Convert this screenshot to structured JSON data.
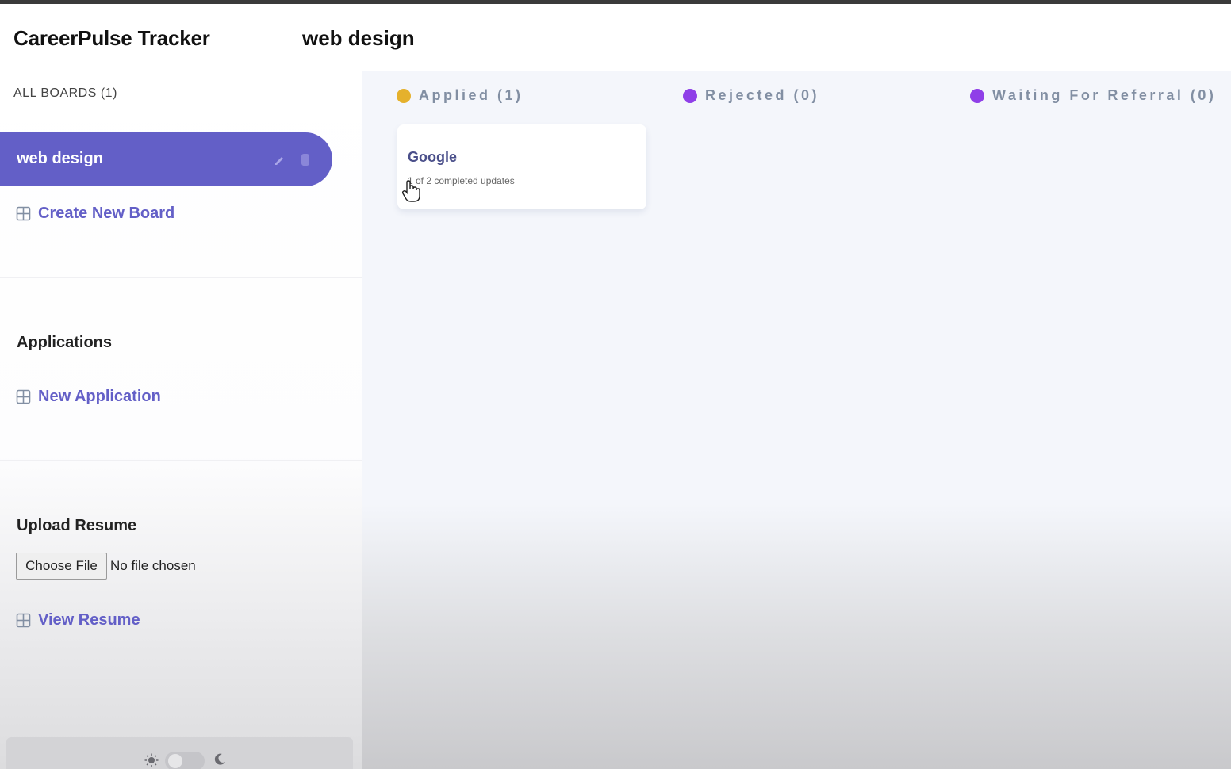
{
  "header": {
    "app_title": "CareerPulse Tracker",
    "board_title": "web design"
  },
  "sidebar": {
    "boards_heading": "ALL BOARDS (1)",
    "boards": [
      {
        "label": "web design",
        "active": true
      }
    ],
    "create_board_label": "Create New Board",
    "applications_title": "Applications",
    "new_application_label": "New Application",
    "upload_title": "Upload Resume",
    "choose_file_label": "Choose File",
    "file_status": "No file chosen",
    "view_resume_label": "View Resume"
  },
  "columns": [
    {
      "label": "Applied (1)",
      "color": "#e5b12c"
    },
    {
      "label": "Rejected (0)",
      "color": "#8f3fe8"
    },
    {
      "label": "Waiting For Referral (0)",
      "color": "#8f3fe8"
    }
  ],
  "cards": [
    {
      "title": "Google",
      "subtitle": "1 of 2 completed updates"
    }
  ],
  "colors": {
    "accent": "#635fc7",
    "text_muted": "#828fa3",
    "board_bg": "#f4f6fb"
  },
  "icons": {
    "board": "board-icon",
    "edit": "pencil-icon",
    "delete": "trash-icon",
    "theme_light": "sun-icon",
    "theme_dark": "moon-icon"
  }
}
